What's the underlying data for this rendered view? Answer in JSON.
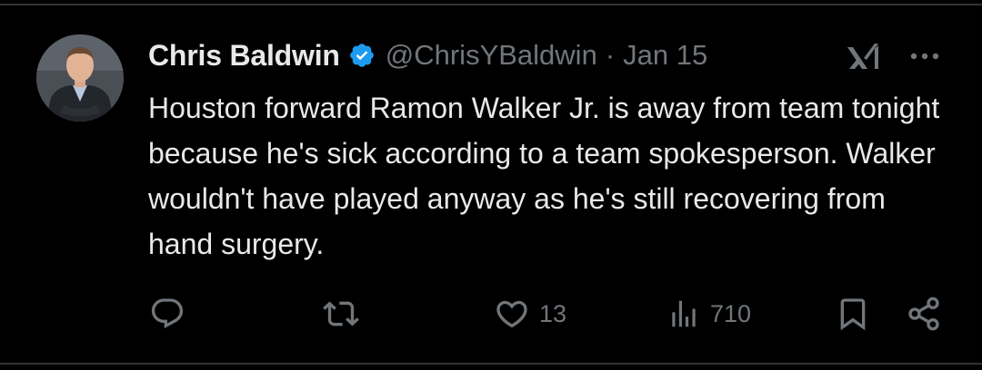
{
  "post": {
    "author": {
      "display_name": "Chris Baldwin",
      "handle": "@ChrisYBaldwin",
      "verified": true,
      "avatar_icon": "profile-photo"
    },
    "separator": "·",
    "timestamp": "Jan 15",
    "text": "Houston forward Ramon Walker Jr. is away from team tonight because he's sick according to a team spokesperson. Walker wouldn't have played anyway as he's still recovering from hand surgery.",
    "header_icons": [
      "grok-icon",
      "more-icon"
    ]
  },
  "actions": {
    "reply": {
      "icon": "reply-icon",
      "count": ""
    },
    "repost": {
      "icon": "repost-icon",
      "count": ""
    },
    "like": {
      "icon": "heart-icon",
      "count": "13"
    },
    "views": {
      "icon": "views-icon",
      "count": "710"
    },
    "bookmark": {
      "icon": "bookmark-icon"
    },
    "share": {
      "icon": "share-icon"
    }
  },
  "colors": {
    "background": "#000000",
    "text_primary": "#e7e9ea",
    "text_secondary": "#71767b",
    "verified_blue": "#1d9bf0",
    "divider": "#2f3336"
  }
}
